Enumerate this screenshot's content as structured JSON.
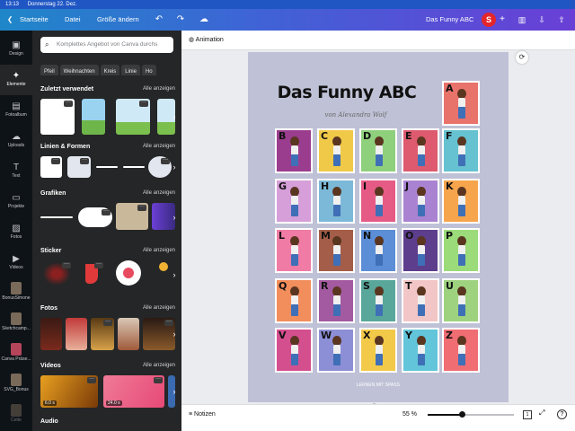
{
  "status": {
    "time": "13:13",
    "date": "Donnerstag 22. Dez."
  },
  "topbar": {
    "home": "Startseite",
    "file": "Datei",
    "resize": "Größe ändern",
    "title": "Das Funny ABC",
    "avatar": "S"
  },
  "rail": [
    {
      "label": "Design",
      "icon": "▣"
    },
    {
      "label": "Elemente",
      "icon": "✦"
    },
    {
      "label": "Fotoalbum",
      "icon": "▤"
    },
    {
      "label": "Uploads",
      "icon": "☁"
    },
    {
      "label": "Text",
      "icon": "T"
    },
    {
      "label": "Projekte",
      "icon": "▭"
    },
    {
      "label": "Fotos",
      "icon": "▨"
    },
    {
      "label": "Videos",
      "icon": "▶"
    },
    {
      "label": "BonusSimone"
    },
    {
      "label": "Sketchcamp..."
    },
    {
      "label": "Canva Präse..."
    },
    {
      "label": "SVG_Bonus"
    },
    {
      "label": "Cette"
    }
  ],
  "panel": {
    "search_placeholder": "Komplettes Angebot von Canva durchs",
    "chips": [
      "Pfeil",
      "Weihnachten",
      "Kreis",
      "Linie",
      "Ho"
    ],
    "see_all": "Alle anzeigen",
    "sections": {
      "recent": "Zuletzt verwendet",
      "lines": "Linien & Formen",
      "graphics": "Grafiken",
      "sticker": "Sticker",
      "photos": "Fotos",
      "videos": "Videos",
      "audio": "Audio"
    },
    "video_durations": [
      "6.0 s",
      "24.0 s"
    ]
  },
  "canvas": {
    "animation": "Animation",
    "page_title": "Das Funny ABC",
    "subtitle": "von Alexandra Wolf",
    "letters": [
      "A",
      "B",
      "C",
      "D",
      "E",
      "F",
      "G",
      "H",
      "I",
      "J",
      "K",
      "L",
      "M",
      "N",
      "O",
      "P",
      "Q",
      "R",
      "S",
      "T",
      "U",
      "V",
      "W",
      "X",
      "Y",
      "Z"
    ],
    "footer": "LERNEN MIT SPASS"
  },
  "bottom": {
    "notes": "Notizen",
    "zoom": "55 %",
    "zoom_fraction": 0.4,
    "page": "1"
  },
  "colors": {
    "A": "#e8736b",
    "B": "#9b3d8f",
    "C": "#f0c948",
    "D": "#8fd07d",
    "E": "#dd5a6f",
    "F": "#66c2d0",
    "G": "#d79fd9",
    "H": "#7cb9d8",
    "I": "#e65b86",
    "J": "#a983d1",
    "K": "#f7a54d",
    "L": "#f07ba4",
    "M": "#a35d48",
    "N": "#5b8ed6",
    "O": "#5d3e8c",
    "P": "#9bdb7a",
    "Q": "#f28d5c",
    "R": "#a35aa0",
    "S": "#58a79a",
    "T": "#f2c6c6",
    "U": "#9ed27f",
    "V": "#d44f8e",
    "W": "#8d8fd6",
    "X": "#f2c948",
    "Y": "#62c5d9",
    "Z": "#f06d73"
  }
}
